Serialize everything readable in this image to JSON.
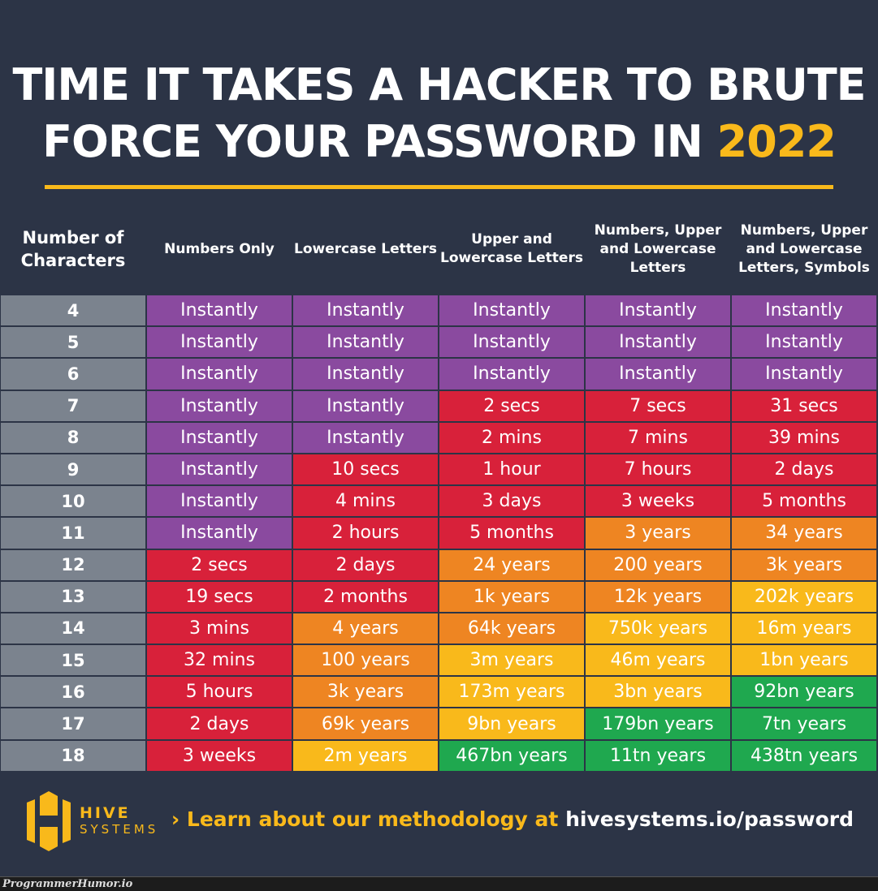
{
  "title": {
    "line1": "TIME IT TAKES A HACKER TO BRUTE",
    "line2": "FORCE YOUR PASSWORD IN",
    "year": "2022"
  },
  "colors": {
    "background": "#2c3446",
    "accent": "#f9b91b",
    "P": "#8a4a9f",
    "R": "#d8213a",
    "O": "#ee8522",
    "Y": "#f9b91b",
    "G": "#1fa84f",
    "gray": "#7b838e"
  },
  "chart_data": {
    "type": "table",
    "columns": [
      "Number of Characters",
      "Numbers Only",
      "Lowercase Letters",
      "Upper and Lowercase Letters",
      "Numbers, Upper and Lowercase Letters",
      "Numbers, Upper and Lowercase Letters, Symbols"
    ],
    "rows": [
      {
        "n": "4",
        "values": [
          "Instantly",
          "Instantly",
          "Instantly",
          "Instantly",
          "Instantly"
        ],
        "colors": "PPPPP"
      },
      {
        "n": "5",
        "values": [
          "Instantly",
          "Instantly",
          "Instantly",
          "Instantly",
          "Instantly"
        ],
        "colors": "PPPPP"
      },
      {
        "n": "6",
        "values": [
          "Instantly",
          "Instantly",
          "Instantly",
          "Instantly",
          "Instantly"
        ],
        "colors": "PPPPP"
      },
      {
        "n": "7",
        "values": [
          "Instantly",
          "Instantly",
          "2 secs",
          "7 secs",
          "31 secs"
        ],
        "colors": "PPRRR"
      },
      {
        "n": "8",
        "values": [
          "Instantly",
          "Instantly",
          "2 mins",
          "7 mins",
          "39 mins"
        ],
        "colors": "PPRRR"
      },
      {
        "n": "9",
        "values": [
          "Instantly",
          "10 secs",
          "1 hour",
          "7 hours",
          "2 days"
        ],
        "colors": "PRRRR"
      },
      {
        "n": "10",
        "values": [
          "Instantly",
          "4 mins",
          "3 days",
          "3 weeks",
          "5 months"
        ],
        "colors": "PRRRR"
      },
      {
        "n": "11",
        "values": [
          "Instantly",
          "2 hours",
          "5 months",
          "3 years",
          "34 years"
        ],
        "colors": "PRROO"
      },
      {
        "n": "12",
        "values": [
          "2 secs",
          "2 days",
          "24 years",
          "200 years",
          "3k years"
        ],
        "colors": "RROOO"
      },
      {
        "n": "13",
        "values": [
          "19 secs",
          "2 months",
          "1k years",
          "12k years",
          "202k years"
        ],
        "colors": "RROOY"
      },
      {
        "n": "14",
        "values": [
          "3 mins",
          "4 years",
          "64k years",
          "750k years",
          "16m years"
        ],
        "colors": "ROOYY"
      },
      {
        "n": "15",
        "values": [
          "32 mins",
          "100 years",
          "3m years",
          "46m years",
          "1bn years"
        ],
        "colors": "ROYYY"
      },
      {
        "n": "16",
        "values": [
          "5 hours",
          "3k years",
          "173m years",
          "3bn years",
          "92bn years"
        ],
        "colors": "ROYYG"
      },
      {
        "n": "17",
        "values": [
          "2 days",
          "69k years",
          "9bn years",
          "179bn years",
          "7tn years"
        ],
        "colors": "ROYGG"
      },
      {
        "n": "18",
        "values": [
          "3 weeks",
          "2m years",
          "467bn years",
          "11tn years",
          "438tn years"
        ],
        "colors": "RYGGG"
      }
    ]
  },
  "logo": {
    "line1": "HIVE",
    "line2": "SYSTEMS"
  },
  "footer": {
    "cta": "Learn about our methodology at",
    "url": "hivesystems.io/password"
  },
  "watermark": "ProgrammerHumor.io"
}
